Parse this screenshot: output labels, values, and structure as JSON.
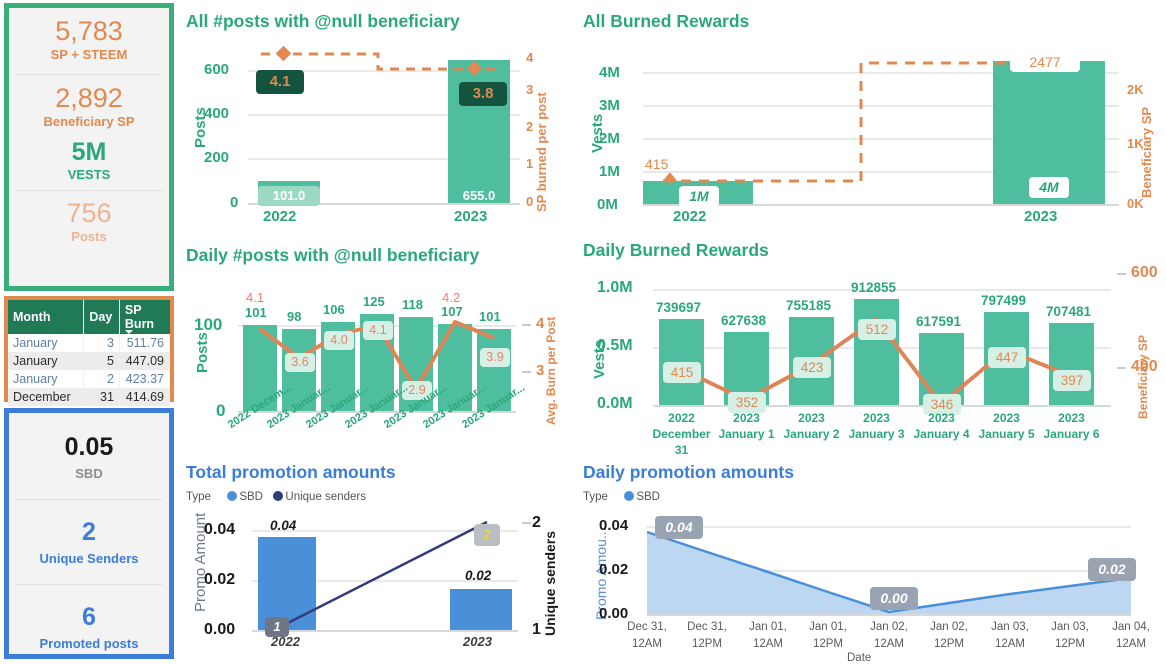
{
  "kpis": {
    "steem": {
      "value": "5,783",
      "label": "SP + STEEM"
    },
    "beneficiary_sp": {
      "value": "2,892",
      "label": "Beneficiary SP"
    },
    "vests": {
      "value": "5M",
      "label": "VESTS"
    },
    "posts": {
      "value": "756",
      "label": "Posts"
    }
  },
  "sp_burn_table": {
    "columns": [
      "Month",
      "Day",
      "SP Burn"
    ],
    "sorted_column": "SP Burn",
    "rows": [
      {
        "month": "January",
        "day": "3",
        "burn": "511.76"
      },
      {
        "month": "January",
        "day": "5",
        "burn": "447.09"
      },
      {
        "month": "January",
        "day": "2",
        "burn": "423.37"
      },
      {
        "month": "December",
        "day": "31",
        "burn": "414.69"
      }
    ]
  },
  "promo_kpis": {
    "sbd": {
      "value": "0.05",
      "label": "SBD"
    },
    "unique_senders": {
      "value": "2",
      "label": "Unique Senders"
    },
    "promoted_posts": {
      "value": "6",
      "label": "Promoted posts"
    }
  },
  "colors": {
    "green_accent": "#2BA87A",
    "green_border": "#3AAF7C",
    "bar_green": "#4FBE9F",
    "orange": "#E2894F",
    "orange_border": "#E08A50",
    "blue": "#3B7DD8",
    "bar_blue": "#4A90D9",
    "navy": "#2E3D7C",
    "dark_green_pill": "#14543F"
  },
  "chart_data": [
    {
      "id": "all-posts-null-beneficiary",
      "type": "bar",
      "title": "All #posts with @null beneficiary",
      "categories": [
        "2022",
        "2023"
      ],
      "series": [
        {
          "name": "Posts",
          "axis": "left",
          "values": [
            101.0,
            655.0
          ],
          "labels": [
            "101.0",
            "655.0"
          ]
        },
        {
          "name": "SP burned per post",
          "axis": "right",
          "values": [
            4.1,
            3.8
          ],
          "labels": [
            "4.1",
            "3.8"
          ],
          "style": "dashed-step-marker"
        }
      ],
      "ylabel": "Posts",
      "y2label": "SP burned per post",
      "yticks": [
        "0",
        "200",
        "400",
        "600"
      ],
      "ylim": [
        0,
        700
      ],
      "y2ticks": [
        "0",
        "1",
        "2",
        "3",
        "4"
      ],
      "y2lim": [
        0,
        4.4
      ],
      "grid": true
    },
    {
      "id": "all-burned-rewards",
      "type": "bar",
      "title": "All Burned Rewards",
      "categories": [
        "2022",
        "2023"
      ],
      "series": [
        {
          "name": "Vests",
          "axis": "left",
          "values": [
            750000,
            4450000
          ],
          "labels": [
            "1M",
            "4M"
          ]
        },
        {
          "name": "Beneficiary SP",
          "axis": "right",
          "values": [
            415,
            2477
          ],
          "labels": [
            "415",
            "2477"
          ],
          "style": "dashed-step-marker"
        }
      ],
      "ylabel": "Vests",
      "y2label": "Beneficiary SP",
      "yticks": [
        "0M",
        "1M",
        "2M",
        "3M",
        "4M"
      ],
      "ylim": [
        0,
        4600000
      ],
      "y2ticks": [
        "0K",
        "1K",
        "2K"
      ],
      "y2lim": [
        0,
        2600
      ],
      "grid": true
    },
    {
      "id": "daily-posts-null-beneficiary",
      "type": "bar",
      "title": "Daily #posts with @null beneficiary",
      "categories": [
        "2022 Decem...",
        "2023 Januar...",
        "2023 Januar...",
        "2023 Januar...",
        "2023 Januar...",
        "2023 Januar...",
        "2023 Januar..."
      ],
      "series": [
        {
          "name": "Posts",
          "axis": "left",
          "values": [
            101,
            98,
            106,
            125,
            118,
            107,
            101
          ],
          "labels": [
            "101",
            "98",
            "106",
            "125",
            "118",
            "107",
            "101"
          ]
        },
        {
          "name": "Avg. Burn per Post",
          "axis": "right",
          "values": [
            4.1,
            3.6,
            4.0,
            4.1,
            2.9,
            4.2,
            3.9
          ],
          "labels": [
            "4.1",
            "3.6",
            "4.0",
            "4.1",
            "2.9",
            "4.2",
            "3.9"
          ],
          "style": "line"
        }
      ],
      "ylabel": "Posts",
      "y2label": "Avg. Burn per Post",
      "yticks": [
        "0",
        "100"
      ],
      "ylim": [
        0,
        135
      ],
      "y2ticks": [
        "3",
        "4"
      ],
      "y2lim": [
        2.75,
        4.35
      ],
      "grid": true
    },
    {
      "id": "daily-burned-rewards",
      "type": "bar",
      "title": "Daily Burned Rewards",
      "categories": [
        "2022 December 31",
        "2023 January 1",
        "2023 January 2",
        "2023 January 3",
        "2023 January 4",
        "2023 January 5",
        "2023 January 6"
      ],
      "series": [
        {
          "name": "Vests",
          "axis": "left",
          "values": [
            739697,
            627638,
            755185,
            912855,
            617591,
            797499,
            707481
          ],
          "labels": [
            "739697",
            "627638",
            "755185",
            "912855",
            "617591",
            "797499",
            "707481"
          ]
        },
        {
          "name": "Beneficiary SP",
          "axis": "right",
          "values": [
            415,
            352,
            423,
            512,
            346,
            447,
            397
          ],
          "labels": [
            "415",
            "352",
            "423",
            "512",
            "346",
            "447",
            "397"
          ],
          "style": "line"
        }
      ],
      "ylabel": "Vests",
      "y2label": "Beneficiary SP",
      "yticks": [
        "0.0M",
        "0.5M",
        "1.0M"
      ],
      "ylim": [
        0,
        1000000
      ],
      "y2ticks": [
        "400",
        "600"
      ],
      "y2lim": [
        320,
        620
      ],
      "grid": true
    },
    {
      "id": "total-promotion-amounts",
      "type": "bar",
      "title": "Total promotion amounts",
      "legend_title": "Type",
      "legend": [
        {
          "label": "SBD",
          "color": "#4A90D9"
        },
        {
          "label": "Unique senders",
          "color": "#2E3D7C"
        }
      ],
      "categories": [
        "2022",
        "2023"
      ],
      "series": [
        {
          "name": "SBD",
          "axis": "left",
          "values": [
            0.037,
            0.016
          ],
          "labels": [
            "0.04",
            "0.02"
          ]
        },
        {
          "name": "Unique senders",
          "axis": "right",
          "values": [
            1,
            2
          ],
          "labels": [
            "1",
            "2"
          ],
          "style": "line"
        }
      ],
      "ylabel": "Promo Amount",
      "y2label": "Unique senders",
      "yticks": [
        "0.00",
        "0.02",
        "0.04"
      ],
      "ylim": [
        0,
        0.042
      ],
      "y2ticks": [
        "1",
        "2"
      ],
      "y2lim": [
        1,
        2
      ],
      "grid": true
    },
    {
      "id": "daily-promotion-amounts",
      "type": "area",
      "title": "Daily promotion amounts",
      "legend_title": "Type",
      "legend": [
        {
          "label": "SBD",
          "color": "#4A90D9"
        }
      ],
      "xlabel": "Date",
      "ylabel": "Promo Amou...",
      "x": [
        "Dec 31, 12AM",
        "Dec 31, 12PM",
        "Jan 01, 12AM",
        "Jan 01, 12PM",
        "Jan 02, 12AM",
        "Jan 02, 12PM",
        "Jan 03, 12AM",
        "Jan 03, 12PM",
        "Jan 04, 12AM"
      ],
      "series": [
        {
          "name": "SBD",
          "values": [
            0.037,
            0.028,
            0.019,
            0.01,
            0.001,
            0.005,
            0.009,
            0.012,
            0.016
          ]
        }
      ],
      "point_labels": [
        {
          "x": "Dec 31, 12AM",
          "text": "0.04"
        },
        {
          "x": "Jan 02, 12AM",
          "text": "0.00"
        },
        {
          "x": "Jan 04, 12AM",
          "text": "0.02"
        }
      ],
      "yticks": [
        "0.00",
        "0.02",
        "0.04"
      ],
      "ylim": [
        0,
        0.042
      ],
      "grid": true
    }
  ]
}
